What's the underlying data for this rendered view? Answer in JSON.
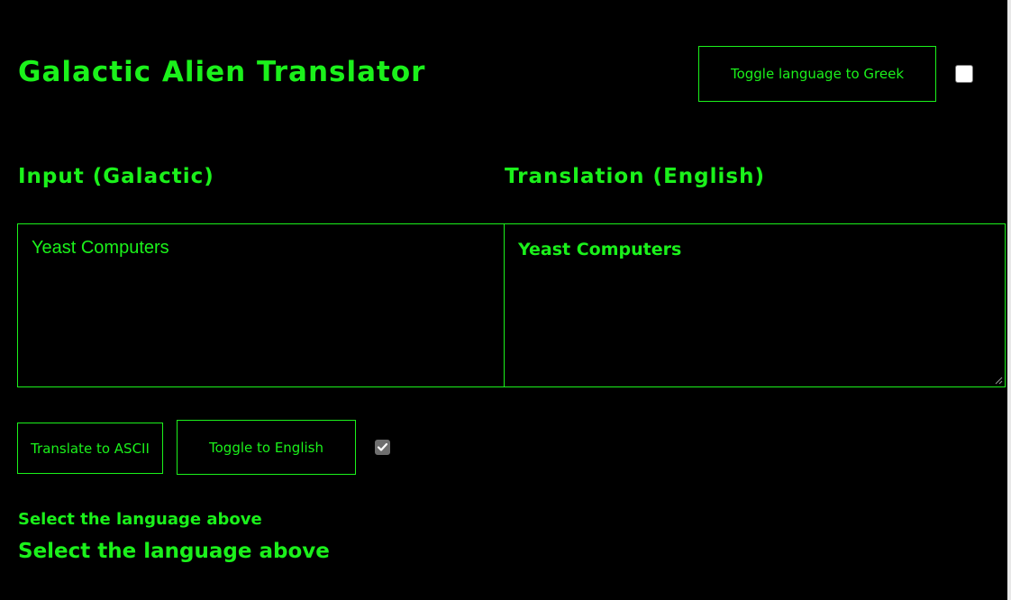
{
  "header": {
    "title": "Galactic Alien Translator",
    "toggle_language_label": "Toggle language to Greek",
    "toggle_language_checked": false
  },
  "input": {
    "label": "Input (Galactic)",
    "value": "Yeast Computers"
  },
  "output": {
    "label": "Translation (English)",
    "value": "Yeast Computers"
  },
  "actions": {
    "translate_label": "Translate to ASCII",
    "toggle_output_label": "Toggle to English",
    "toggle_output_checked": true
  },
  "footer": {
    "line1": "Select the language above",
    "line2": "Select the language above"
  },
  "colors": {
    "background": "#000000",
    "accent": "#1bf11b"
  }
}
